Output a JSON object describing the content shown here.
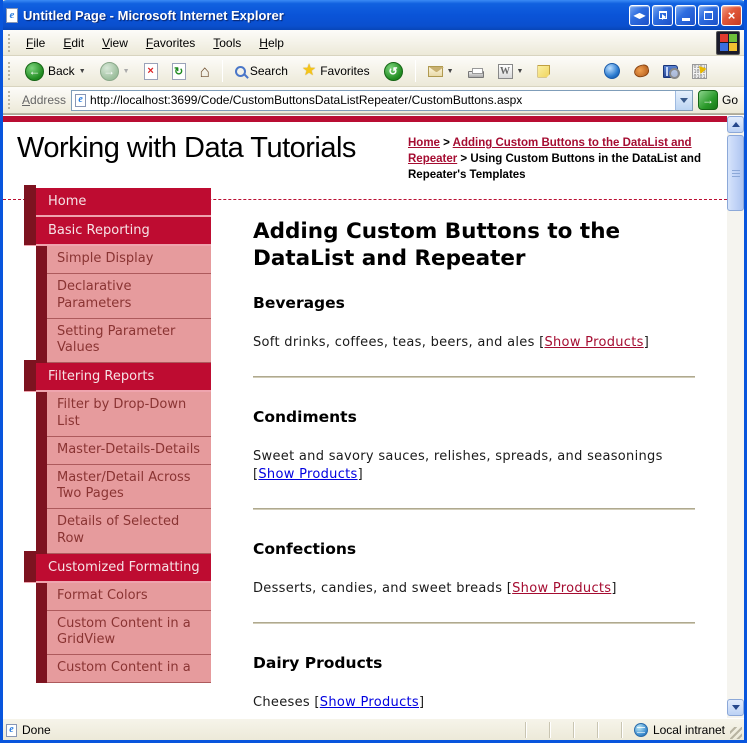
{
  "window": {
    "title": "Untitled Page - Microsoft Internet Explorer"
  },
  "icons": {
    "ie_e": "e",
    "pan_glyph": "◀▶",
    "close_glyph": "×",
    "back_arrow": "←",
    "forward_arrow": "→",
    "stop_glyph": "×",
    "refresh_glyph": "↻",
    "home_glyph": "⌂",
    "star_glyph": "★",
    "history_glyph": "↺",
    "word_glyph": "W",
    "binary_glyph": "0101 1010 0101",
    "go_arrow": "→",
    "breadcrumb_sep": ">"
  },
  "menu_bar": {
    "items": [
      "File",
      "Edit",
      "View",
      "Favorites",
      "Tools",
      "Help"
    ]
  },
  "toolbar": {
    "back_label": "Back",
    "search_label": "Search",
    "favorites_label": "Favorites"
  },
  "address_bar": {
    "label": "Address",
    "url": "http://localhost:3699/Code/CustomButtonsDataListRepeater/CustomButtons.aspx",
    "go_label": "Go"
  },
  "page": {
    "site_title": "Working with Data Tutorials",
    "breadcrumb": {
      "home": "Home",
      "section": "Adding Custom Buttons to the DataList and Repeater",
      "current": "Using Custom Buttons in the DataList and Repeater's Templates"
    },
    "sidebar": [
      {
        "label": "Home"
      },
      {
        "label": "Basic Reporting"
      },
      {
        "label": "Simple Display"
      },
      {
        "label": "Declarative Parameters"
      },
      {
        "label": "Setting Parameter Values"
      },
      {
        "label": "Filtering Reports"
      },
      {
        "label": "Filter by Drop-Down List"
      },
      {
        "label": "Master-Details-Details"
      },
      {
        "label": "Master/Detail Across Two Pages"
      },
      {
        "label": "Details of Selected Row"
      },
      {
        "label": "Customized Formatting"
      },
      {
        "label": "Format Colors"
      },
      {
        "label": "Custom Content in a GridView"
      },
      {
        "label": "Custom Content in a"
      }
    ],
    "main": {
      "title": "Adding Custom Buttons to the DataList and Repeater",
      "bracket_open": "[",
      "bracket_close": "]",
      "categories": [
        {
          "name": "Beverages",
          "description": "Soft drinks, coffees, teas, beers, and ales ",
          "link": "Show Products",
          "visited": true
        },
        {
          "name": "Condiments",
          "description": "Sweet and savory sauces, relishes, spreads, and seasonings ",
          "link": "Show Products",
          "visited": false
        },
        {
          "name": "Confections",
          "description": "Desserts, candies, and sweet breads ",
          "link": "Show Products",
          "visited": true
        },
        {
          "name": "Dairy Products",
          "description": "Cheeses ",
          "link": "Show Products",
          "visited": false
        }
      ]
    }
  },
  "status_bar": {
    "left": "Done",
    "right": "Local intranet"
  },
  "colors": {
    "accent_red": "#BE0C31",
    "dark_maroon": "#7D1320",
    "menu_pink": "#E69B9D",
    "menu_pink_text": "#8A3433",
    "link_blue": "#0000E0",
    "link_visited": "#A50C31",
    "titlebar_blue": "#0A54D8",
    "chrome_beige": "#ECE9D8"
  }
}
